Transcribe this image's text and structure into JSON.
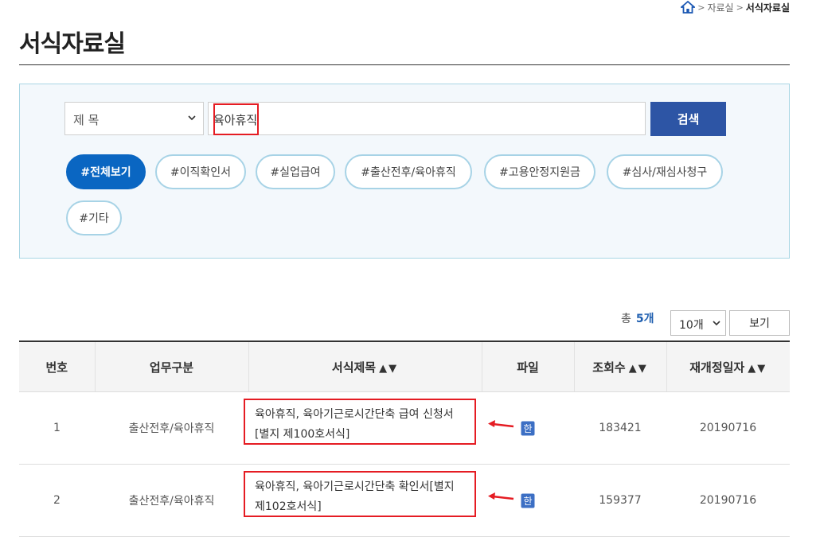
{
  "breadcrumb": {
    "sep": ">",
    "items": [
      "자료실",
      "서식자료실"
    ]
  },
  "page": {
    "title": "서식자료실"
  },
  "search": {
    "field_selected": "제 목",
    "keyword": "육아휴직",
    "button": "검색"
  },
  "tags": [
    "#전체보기",
    "#이직확인서",
    "#실업급여",
    "#출산전후/육아휴직",
    "#고용안정지원금",
    "#심사/재심사청구",
    "#기타"
  ],
  "list": {
    "total_prefix": "총",
    "total_count": "5개",
    "per_page": "10개",
    "view_button": "보기"
  },
  "table": {
    "columns": [
      "번호",
      "업무구분",
      "서식제목",
      "파일",
      "조회수",
      "재개정일자"
    ],
    "sort_markers": "▲▼",
    "rows": [
      {
        "no": "1",
        "category": "출산전후/육아휴직",
        "title": "육아휴직, 육아기근로시간단축 급여 신청서[별지 제100호서식]",
        "file": "hwp",
        "views": "183421",
        "date": "20190716"
      },
      {
        "no": "2",
        "category": "출산전후/육아휴직",
        "title": "육아휴직, 육아기근로시간단축 확인서[별지 제102호서식]",
        "file": "hwp",
        "views": "159377",
        "date": "20190716"
      }
    ]
  },
  "colors": {
    "accent": "#0a66c2",
    "button": "#2d55a5",
    "highlight": "#e51c23",
    "tag_border": "#a7d3e6"
  }
}
